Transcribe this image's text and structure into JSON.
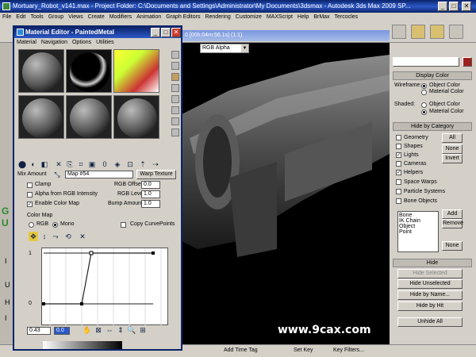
{
  "app": {
    "title": "Mortuary_Robot_v141.max   - Project Folder: C:\\Documents and Settings\\Administrator\\My Documents\\3dsmax   - Autodesk 3ds Max  2009 SP...",
    "menu": [
      "File",
      "Edit",
      "Tools",
      "Group",
      "Views",
      "Create",
      "Modifiers",
      "Animation",
      "Graph Editors",
      "Rendering",
      "Customize",
      "MAXScript",
      "Help",
      "BrMax",
      "Tercocles"
    ]
  },
  "viewport": {
    "title": "0 [00h:04m:56.1s] (1:1)",
    "channel": "RGB Alpha",
    "watermark": "www.9cax.com"
  },
  "material_editor": {
    "title": "Material Editor - PaintedMetal",
    "menu": [
      "Material",
      "Navigation",
      "Options",
      "Utilities"
    ],
    "mix_amount_label": "Mix Amount",
    "map_name": "Map #54",
    "warp_texture_label": "Warp Texture",
    "clamp_label": "Clamp",
    "alpha_rgb_label": "Alpha from RGB Intensity",
    "enable_color_map_label": "Enable Color Map",
    "rgb_offset_label": "RGB Offset",
    "rgb_offset_value": "0.0",
    "rgb_level_label": "RGB Level",
    "rgb_level_value": "1.0",
    "bump_amount_label": "Bump Amount",
    "bump_amount_value": "1.0",
    "color_map_label": "Color Map",
    "rgb_label": "RGB",
    "mono_label": "Mono",
    "copy_curve_label": "Copy CurvePoints",
    "curve_y_top": "1",
    "curve_y_bottom": "0",
    "curve_x_value": "0.43",
    "curve_y_value": "0.0"
  },
  "right_panel": {
    "display_color_label": "Display Color",
    "wireframe_label": "Wireframe:",
    "shaded_label": "Shaded:",
    "object_color_label": "Object Color",
    "material_color_label": "Material Color",
    "hide_by_category_label": "Hide by Category",
    "categories": [
      "Geometry",
      "Shapes",
      "Lights",
      "Cameras",
      "Helpers",
      "Space Warps",
      "Particle Systems",
      "Bone Objects"
    ],
    "all_label": "All",
    "none_label": "None",
    "invert_label": "Invert",
    "list_items": [
      "Bone",
      "IK Chain Object",
      "Point"
    ],
    "add_label": "Add",
    "remove_label": "Remove",
    "none2_label": "None",
    "hide_label": "Hide",
    "hide_selected_label": "Hide Selected",
    "hide_unselected_label": "Hide Unselected",
    "hide_by_name_label": "Hide by Name...",
    "hide_by_hit_label": "Hide by Hit",
    "unhide_all_label": "Unhide All"
  },
  "bottom_bar": {
    "add_time_tag": "Add Time Tag",
    "set_key": "Set Key",
    "key_filters": "Key Filters..."
  }
}
